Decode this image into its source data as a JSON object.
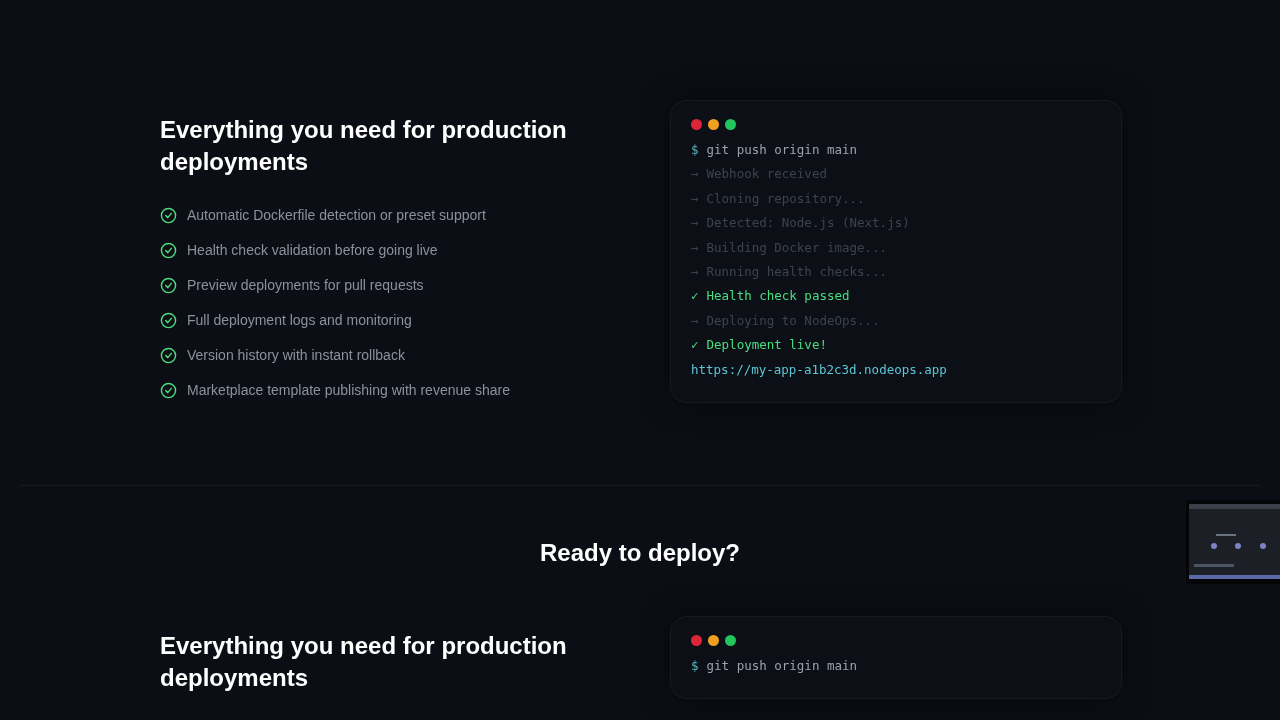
{
  "sections": [
    {
      "heading": "Everything you need for production deployments",
      "features": [
        "Automatic Dockerfile detection or preset support",
        "Health check validation before going live",
        "Preview deployments for pull requests",
        "Full deployment logs and monitoring",
        "Version history with instant rollback",
        "Marketplace template publishing with revenue share"
      ],
      "terminal": {
        "lines": [
          {
            "kind": "command",
            "marker": "$",
            "text": "git push origin main"
          },
          {
            "kind": "step",
            "marker": "→",
            "text": "Webhook received"
          },
          {
            "kind": "step",
            "marker": "→",
            "text": "Cloning repository..."
          },
          {
            "kind": "step",
            "marker": "→",
            "text": "Detected: Node.js (Next.js)"
          },
          {
            "kind": "step",
            "marker": "→",
            "text": "Building Docker image..."
          },
          {
            "kind": "step",
            "marker": "→",
            "text": "Running health checks..."
          },
          {
            "kind": "success",
            "marker": "✓",
            "text": "Health check passed"
          },
          {
            "kind": "step",
            "marker": "→",
            "text": "Deploying to NodeOps..."
          },
          {
            "kind": "success",
            "marker": "✓",
            "text": "Deployment live!"
          },
          {
            "kind": "url",
            "text": "https://my-app-a1b2c3d.nodeops.app"
          }
        ]
      }
    },
    {
      "kind": "cta",
      "heading": "Ready to deploy?"
    },
    {
      "heading": "Everything you need for production deployments",
      "terminal": {
        "lines": [
          {
            "kind": "command",
            "marker": "$",
            "text": "git push origin main"
          }
        ]
      }
    }
  ]
}
